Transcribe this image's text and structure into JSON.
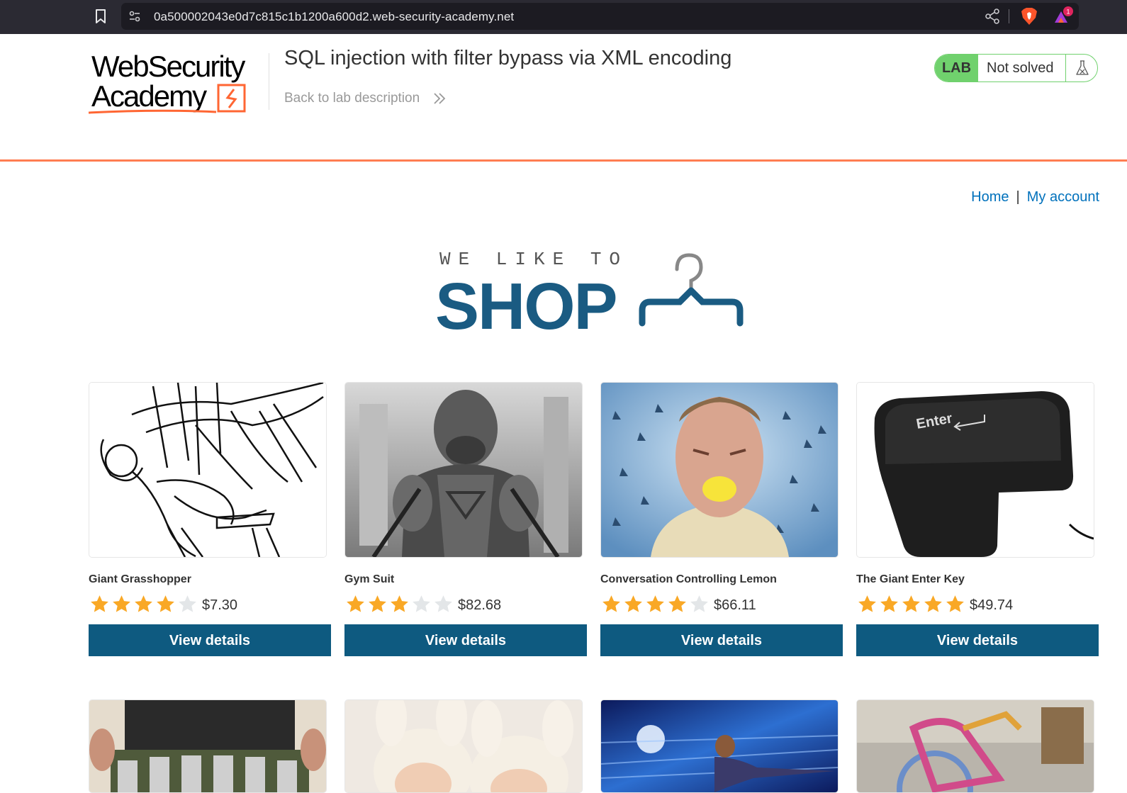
{
  "browser": {
    "url": "0a500002043e0d7c815c1b1200a600d2.web-security-academy.net",
    "notification_count": "1"
  },
  "lab": {
    "logo_line1": "WebSecurity",
    "logo_line2": "Academy",
    "title": "SQL injection with filter bypass via XML encoding",
    "back_link": "Back to lab description",
    "badge": "LAB",
    "status": "Not solved",
    "status_color": "#70d16d"
  },
  "nav": {
    "home": "Home",
    "separator": "|",
    "my_account": "My account"
  },
  "banner": {
    "line1": "WE LIKE TO",
    "line2": "SHOP"
  },
  "products": [
    {
      "name": "Giant Grasshopper",
      "rating": 4,
      "price": "$7.30",
      "button": "View details"
    },
    {
      "name": "Gym Suit",
      "rating": 3,
      "price": "$82.68",
      "button": "View details"
    },
    {
      "name": "Conversation Controlling Lemon",
      "rating": 4,
      "price": "$66.11",
      "button": "View details"
    },
    {
      "name": "The Giant Enter Key",
      "rating": 5,
      "price": "$49.74",
      "button": "View details"
    }
  ],
  "colors": {
    "accent_orange": "#ff6633",
    "button_blue": "#0e5a80",
    "link_blue": "#0071bc",
    "star_gold": "#f9a826",
    "star_empty": "#e3e6e8"
  }
}
